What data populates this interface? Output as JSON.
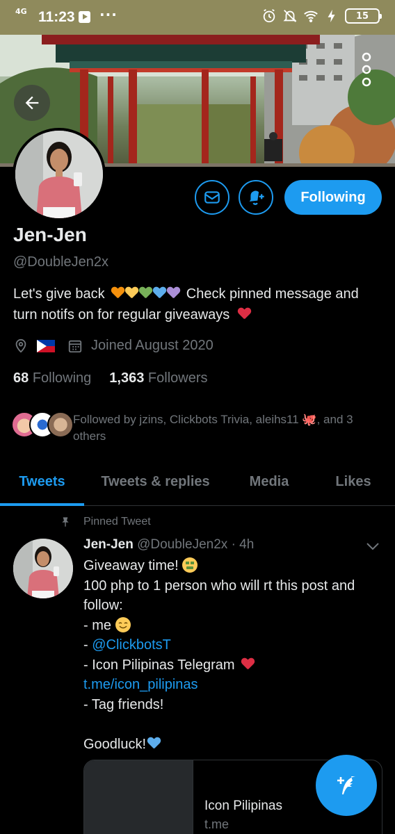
{
  "status_bar": {
    "network": "4G",
    "time": "11:23",
    "battery": "15"
  },
  "profile": {
    "name": "Jen-Jen",
    "handle": "@DoubleJen2x",
    "bio_part1": "Let's give back",
    "bio_part2": "Check pinned message and turn notifs on for regular giveaways",
    "joined": "Joined August 2020",
    "following_count": "68",
    "following_label": "Following",
    "followers_count": "1,363",
    "followers_label": "Followers",
    "followed_by": "Followed by jzins, Clickbots Trivia, aleihs11 🐙, and 3 others",
    "follow_button": "Following",
    "heart_colors": [
      "#f4900c",
      "#fdcb58",
      "#78b159",
      "#5dadec",
      "#aa8ed6"
    ]
  },
  "tabs": [
    {
      "label": "Tweets",
      "active": true
    },
    {
      "label": "Tweets & replies",
      "active": false
    },
    {
      "label": "Media",
      "active": false
    },
    {
      "label": "Likes",
      "active": false
    }
  ],
  "tweet": {
    "pinned_label": "Pinned Tweet",
    "author": "Jen-Jen",
    "handle": "@DoubleJen2x",
    "time": "· 4h",
    "line1": "Giveaway time!",
    "line2": "100 php to 1 person who will rt this post and",
    "line3": "follow:",
    "line4": "- me",
    "line5_prefix": "- ",
    "line5_link": "@ClickbotsT",
    "line6": "- Icon Pilipinas Telegram",
    "line7_link": "t.me/icon_pilipinas",
    "line8": "- Tag friends!",
    "line9": "Goodluck!",
    "card_title": "Icon Pilipinas",
    "card_domain": "t.me"
  },
  "colors": {
    "accent": "#1d9bf0",
    "background": "#000000",
    "secondary_text": "#71767b",
    "status_bar": "#8f8a5c"
  }
}
